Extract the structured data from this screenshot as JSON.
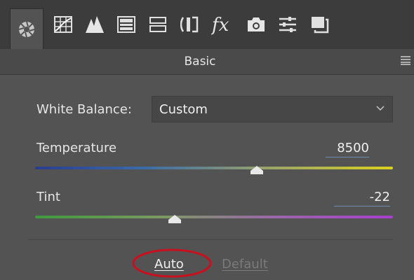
{
  "toolbar": {
    "tabs": [
      {
        "icon": "aperture-icon",
        "active": true
      },
      {
        "icon": "tone-curve-icon"
      },
      {
        "icon": "detail-icon"
      },
      {
        "icon": "hsl-icon"
      },
      {
        "icon": "split-toning-icon"
      },
      {
        "icon": "lens-corrections-icon"
      },
      {
        "icon": "effects-fx-icon"
      },
      {
        "icon": "camera-calibration-icon"
      },
      {
        "icon": "presets-icon"
      },
      {
        "icon": "snapshots-icon"
      }
    ]
  },
  "panel": {
    "title": "Basic",
    "white_balance": {
      "label": "White Balance:",
      "value": "Custom"
    },
    "temperature": {
      "label": "Temperature",
      "value": "8500",
      "position": 0.62
    },
    "tint": {
      "label": "Tint",
      "value": "-22",
      "position": 0.39
    },
    "buttons": {
      "auto": "Auto",
      "default": "Default"
    }
  },
  "colors": {
    "panel_bg": "#535353",
    "toolbar_bg": "#3c3c3c",
    "highlight_circle": "#c8101e"
  }
}
